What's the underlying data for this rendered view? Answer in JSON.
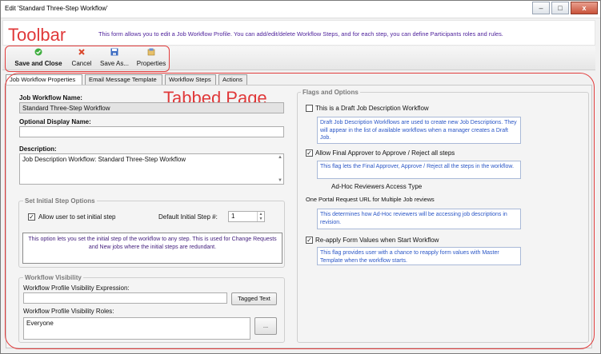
{
  "window": {
    "title": "Edit 'Standard Three-Step Workflow'",
    "controls": {
      "minimize": "–",
      "maximize": "□",
      "close": "x"
    }
  },
  "info": {
    "text": "This form allows you to edit a Job Workflow Profile. You can add/edit/delete Workflow Steps, and for each step, you can define Participants roles and rules."
  },
  "annotations": {
    "toolbar": "Toolbar",
    "tabbed_page": "Tabbed Page",
    "color": "#e0393a"
  },
  "toolbar": {
    "save_close": "Save and Close",
    "cancel": "Cancel",
    "save_as": "Save As...",
    "properties": "Properties"
  },
  "tabs": [
    {
      "label": "Job Workflow Properties"
    },
    {
      "label": "Email Message Template"
    },
    {
      "label": "Workflow Steps"
    },
    {
      "label": "Actions"
    }
  ],
  "left": {
    "workflow_name_label": "Job Workflow Name:",
    "workflow_name_value": "Standard Three-Step Workflow",
    "display_name_label": "Optional Display Name:",
    "display_name_value": "",
    "description_label": "Description:",
    "description_value": "Job Description Workflow: Standard Three-Step Workflow",
    "initial_step_group": "Set Initial Step Options",
    "allow_user_label": "Allow user to set initial step",
    "allow_user_checked": true,
    "default_step_label": "Default Initial Step #:",
    "default_step_value": "1",
    "initial_step_note": "This option lets you set the initial step of the workflow to any step.  This is used for Change Requests and New jobs where the initial steps are redundant.",
    "visibility_group": "Workflow Visibility",
    "visibility_expr_label": "Workflow Profile Visibility Expression:",
    "visibility_expr_value": "",
    "tagged_text_button": "Tagged Text",
    "visibility_roles_label": "Workflow Profile Visibility Roles:",
    "visibility_roles_value": "Everyone",
    "ellipsis_button": "..."
  },
  "right": {
    "group_title": "Flags and Options",
    "draft_label": "This is a Draft Job Description Workflow",
    "draft_checked": false,
    "draft_note": "Draft Job Description Workflows are used to create new Job Descriptions. They will appear in the list of available workflows when a manager creates a Draft Job.",
    "final_approver_label": "Allow Final Approver to Approve / Reject all steps",
    "final_approver_checked": true,
    "final_approver_note": "This flag lets the Final Approver, Approve / Reject all the steps in the workflow.",
    "adhoc_label": "Ad-Hoc Reviewers Access Type",
    "adhoc_value": "One Portal Request URL for Multiple Job reviews",
    "adhoc_note": "This determines how Ad-Hoc reviewers will be accessing job descriptions in revision.",
    "reapply_label": "Re-apply Form Values when Start Workflow",
    "reapply_checked": true,
    "reapply_note": "This flag provides user with a chance to reapply form values with Master Template when the workflow starts."
  }
}
